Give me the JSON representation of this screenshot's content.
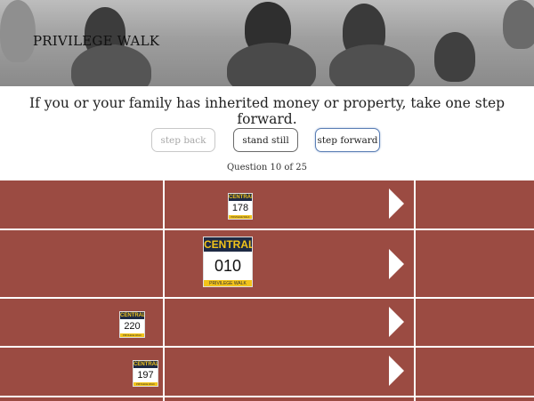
{
  "header": {
    "title": "PRIVILEGE WALK"
  },
  "question": {
    "text": "If you or your family has inherited money or property, take one step forward."
  },
  "buttons": {
    "back_label": "step back",
    "still_label": "stand still",
    "forward_label": "step forward"
  },
  "progress": {
    "text": "Question 10 of 25"
  },
  "bib_brand": "CENTRAL",
  "bib_footer": "PRIVILEGE WALK",
  "runners": [
    {
      "number": "178"
    },
    {
      "number": "010"
    },
    {
      "number": "220"
    },
    {
      "number": "197"
    }
  ],
  "colors": {
    "track": "#9b4b42",
    "bib_top": "#1e2a44",
    "bib_accent": "#f2c31a"
  }
}
